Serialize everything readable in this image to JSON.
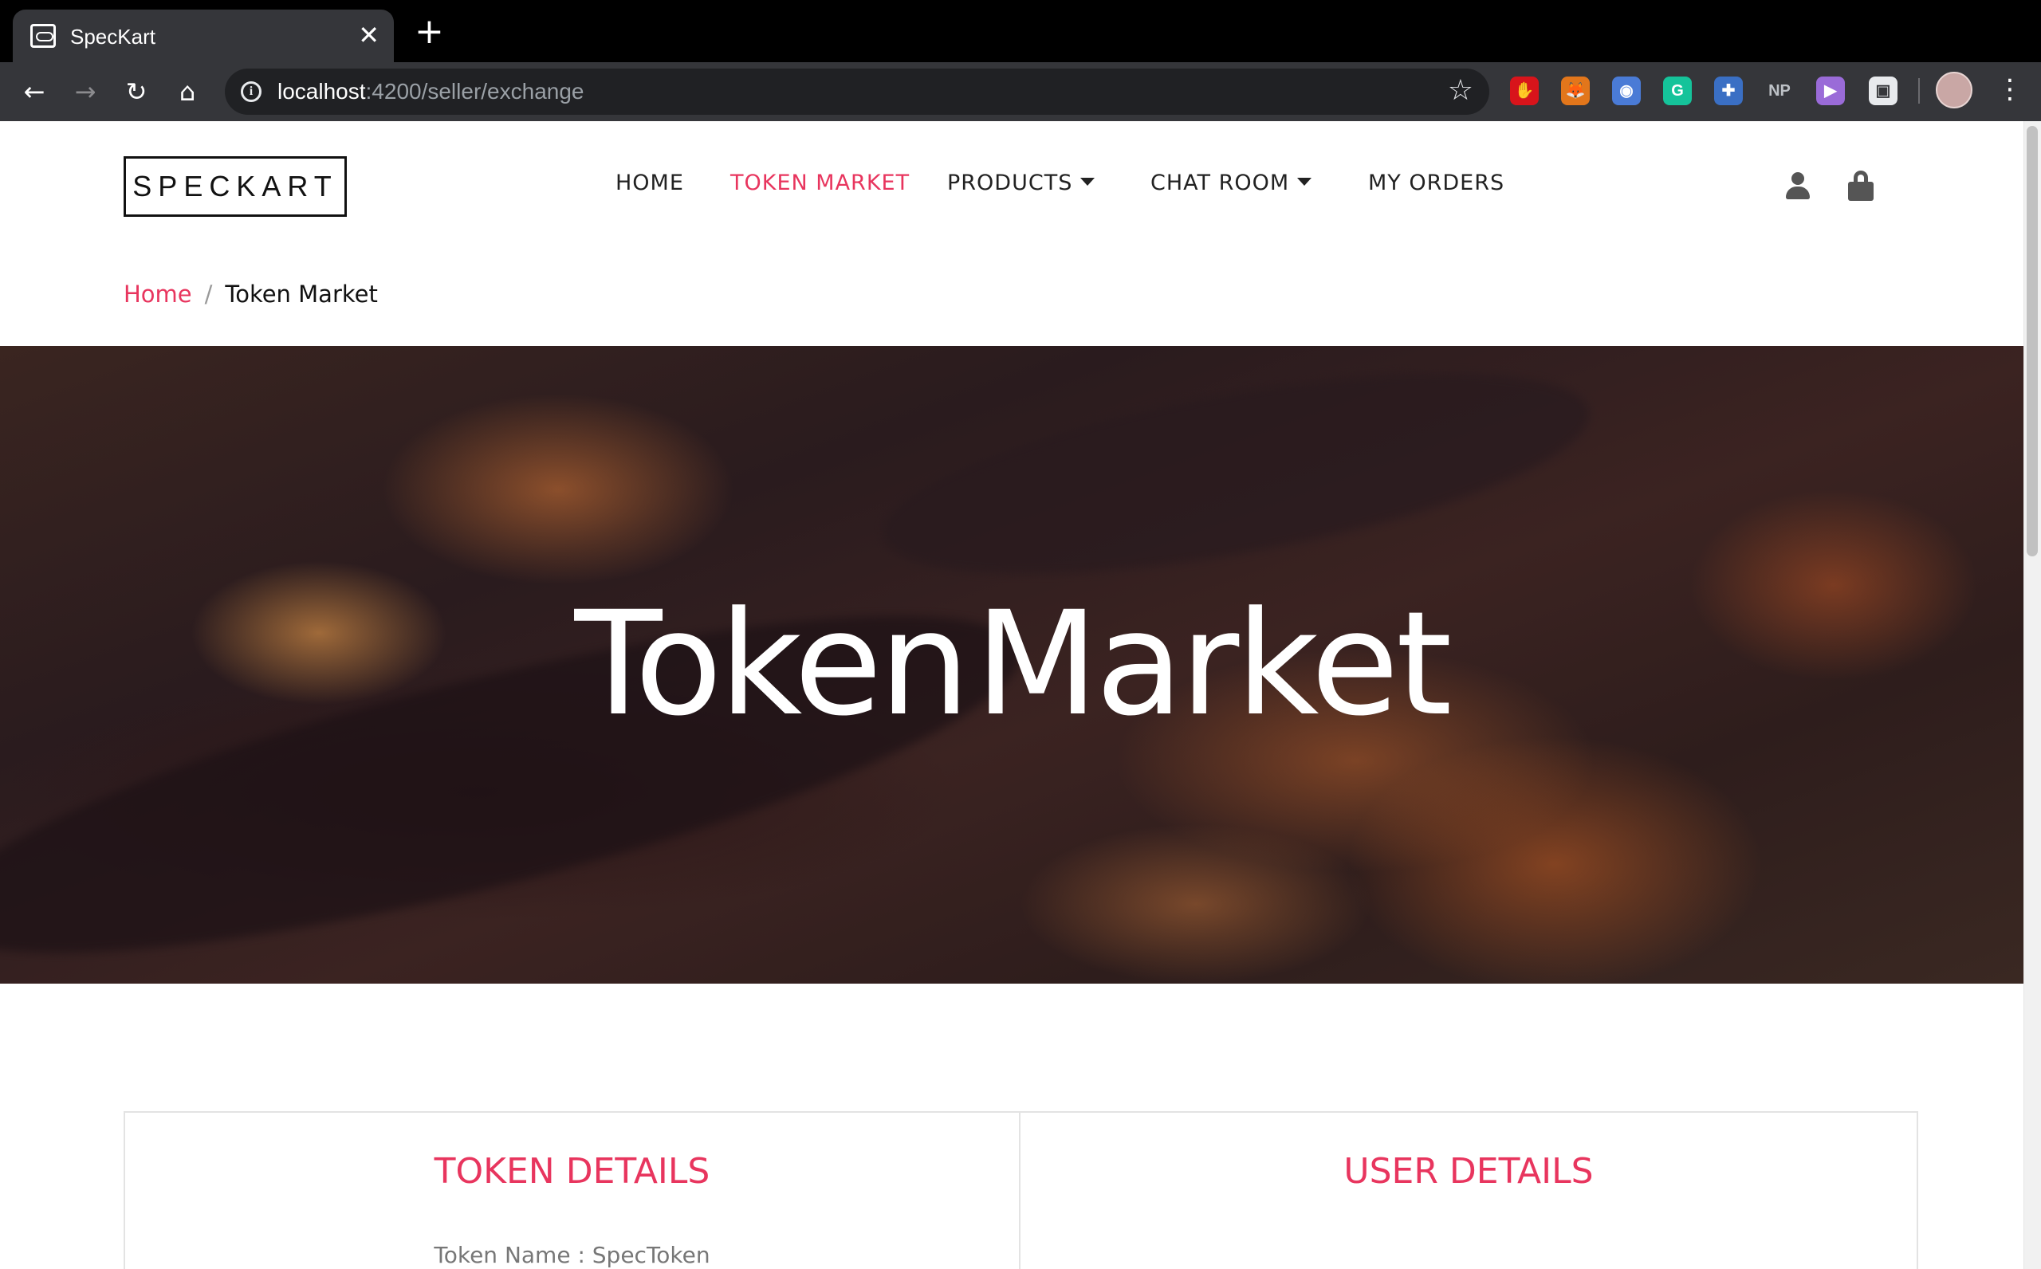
{
  "browser": {
    "tab_title": "SpecKart",
    "tab_close": "✕",
    "new_tab": "+",
    "url_host": "localhost",
    "url_path": ":4200/seller/exchange",
    "extensions": [
      {
        "name": "adblock-icon",
        "color": "#d8141b",
        "glyph": "✋"
      },
      {
        "name": "metamask-icon",
        "color": "#e2761b",
        "glyph": "🦊"
      },
      {
        "name": "camera-icon",
        "color": "#4a7bd6",
        "glyph": "◉"
      },
      {
        "name": "grammarly-icon",
        "color": "#15c39a",
        "glyph": "G"
      },
      {
        "name": "tools-icon",
        "color": "#3a6fc4",
        "glyph": "✚"
      },
      {
        "name": "np-icon",
        "color": "#35363a",
        "glyph": "NP"
      },
      {
        "name": "play-icon",
        "color": "#9a6bd8",
        "glyph": "▶"
      },
      {
        "name": "screenshot-icon",
        "color": "#e8eaed",
        "glyph": "▣"
      }
    ]
  },
  "site": {
    "logo": "SPECKART",
    "nav": {
      "home": "HOME",
      "token_market": "TOKEN MARKET",
      "products": "PRODUCTS",
      "chat_room": "CHAT ROOM",
      "my_orders": "MY ORDERS"
    },
    "breadcrumb": {
      "home": "Home",
      "separator": "/",
      "current": "Token Market"
    },
    "hero": {
      "title_part1": "Token",
      "title_part2": "Market"
    },
    "panels": {
      "token_details_title": "TOKEN DETAILS",
      "token_name_line": "Token Name : SpecToken",
      "user_details_title": "USER DETAILS"
    },
    "accent_color": "#e8355e"
  }
}
